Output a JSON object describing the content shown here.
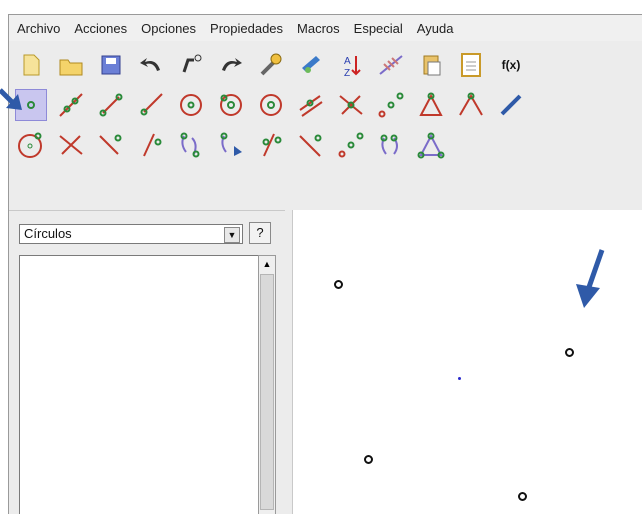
{
  "menu": [
    "Archivo",
    "Acciones",
    "Opciones",
    "Propiedades",
    "Macros",
    "Especial",
    "Ayuda"
  ],
  "toolbar": {
    "row1": [
      "new-file-icon",
      "open-folder-icon",
      "save-disk-icon",
      "undo-icon",
      "point-variable-icon",
      "redo-icon",
      "wrench-icon",
      "hand-pen-icon",
      "sort-az-icon",
      "hatch-icon",
      "clipboard-paste-icon",
      "document-icon",
      "fx-icon"
    ],
    "fx_label": "f(x)",
    "row2": [
      "point-tool-icon",
      "line-tool-icon",
      "segment-tool-icon",
      "ray-tool-icon",
      "circle-tool-icon",
      "circle-center-tool-icon",
      "circle-radius-tool-icon",
      "parallel-tool-icon",
      "intersection-tool-icon",
      "midpoint-tool-icon",
      "triangle-tool-icon",
      "angle-tool-icon",
      "pen-tool-icon"
    ],
    "row3": [
      "circle-3pt-tool-icon",
      "cross-tool-icon",
      "perpendicular-tool-icon",
      "bisector-tool-icon",
      "symmetry-tool-icon",
      "translate-tool-icon",
      "rotate-tool-icon",
      "perpendicular-line-tool-icon",
      "locus-tool-icon",
      "transform-tool-icon",
      "polygon-tool-icon"
    ]
  },
  "side_panel": {
    "dropdown_value": "Círculos",
    "help_label": "?"
  },
  "colors": {
    "accent_arrow": "#2f5aa8",
    "selected_tool_bg": "#c9c6ef"
  }
}
